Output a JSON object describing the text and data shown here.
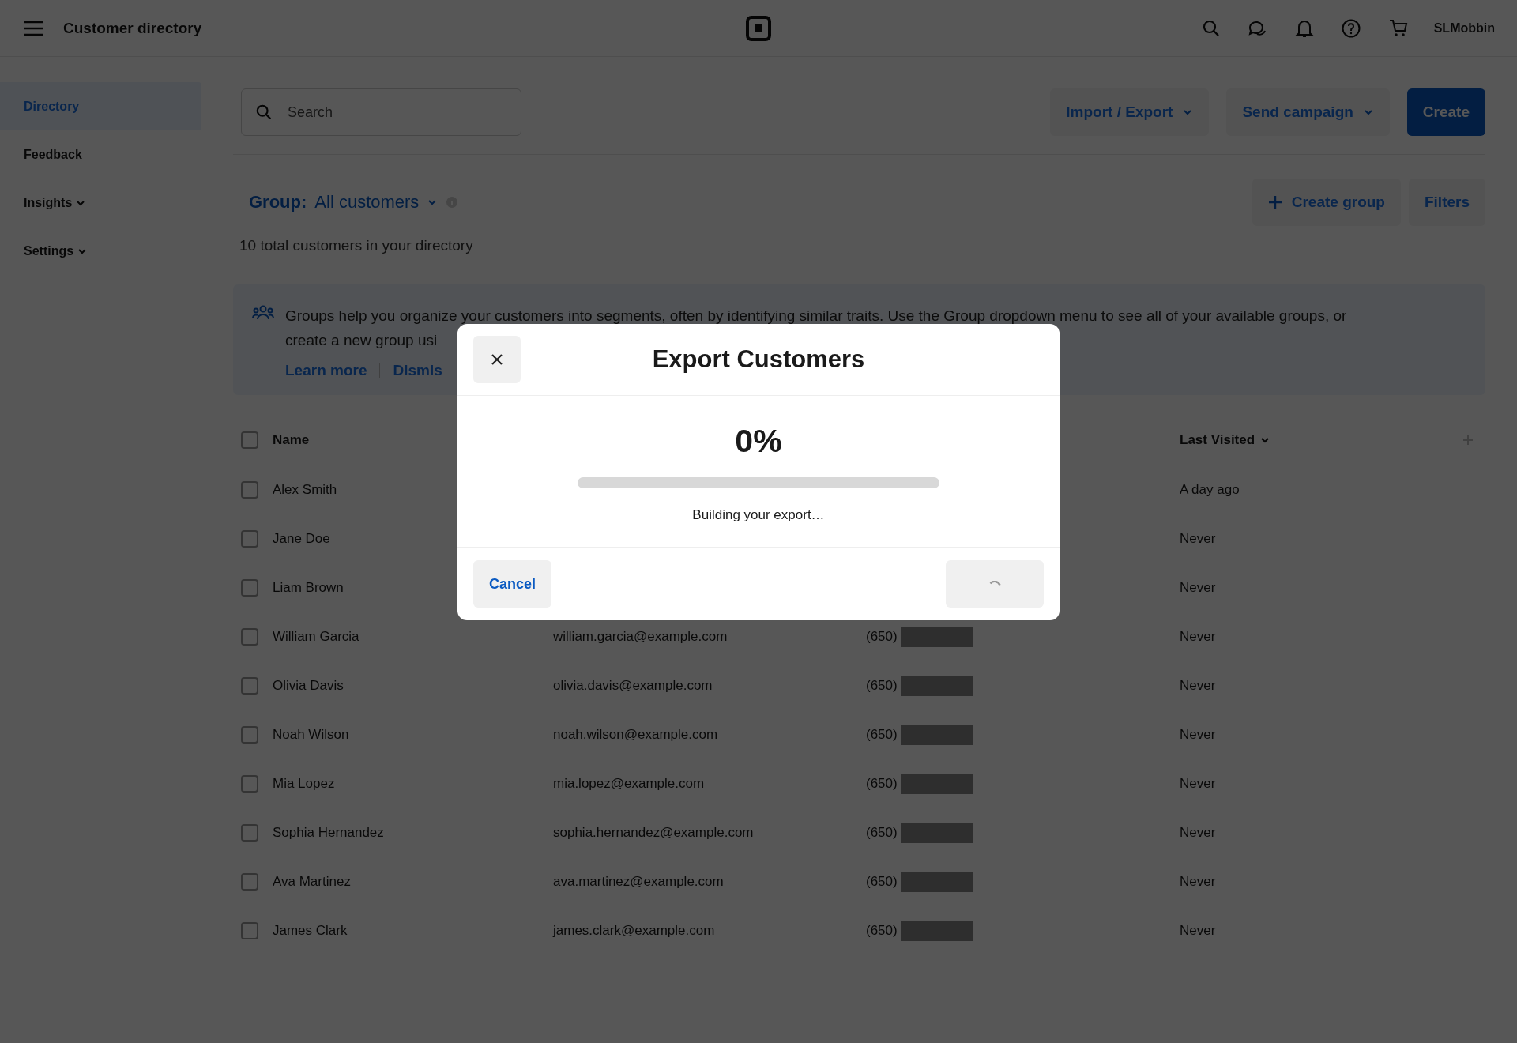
{
  "topbar": {
    "title": "Customer directory",
    "user": "SLMobbin"
  },
  "sidebar": {
    "items": [
      {
        "label": "Directory",
        "selected": true,
        "kind": "link"
      },
      {
        "label": "Feedback",
        "selected": false,
        "kind": "link"
      },
      {
        "label": "Insights",
        "selected": false,
        "kind": "menu"
      },
      {
        "label": "Settings",
        "selected": false,
        "kind": "menu"
      }
    ]
  },
  "toolbar": {
    "search": {
      "placeholder": "Search"
    },
    "buttons": [
      {
        "label": "Import / Export",
        "kind": "dropdown"
      },
      {
        "label": "Send campaign",
        "kind": "dropdown"
      },
      {
        "label": "Create",
        "kind": "primary"
      }
    ]
  },
  "group": {
    "label": "Group:",
    "value": "All customers",
    "count_text": "10 total customers in your directory",
    "buttons": [
      {
        "label": "Create group",
        "kind": "add"
      },
      {
        "label": "Filters",
        "kind": "plain"
      }
    ]
  },
  "banner": {
    "lines": [
      "Groups help you organize your customers into segments, often by identifying similar traits. Use the Group dropdown menu to see all of your available groups, or",
      "create a new group usi"
    ],
    "links": [
      "Learn more",
      "Dismis"
    ]
  },
  "table": {
    "header_checked": false,
    "columns": [
      {
        "label": "Name"
      },
      {
        "label": "Last Visited"
      }
    ],
    "rows": [
      {
        "name": "Alex Smith",
        "last_visited": "A day ago",
        "checked": false
      },
      {
        "name": "Jane Doe",
        "last_visited": "Never",
        "checked": false
      },
      {
        "name": "Liam Brown",
        "last_visited": "Never",
        "checked": false
      },
      {
        "name": "William Garcia",
        "email": "william.garcia@example.com",
        "phone": "(650)",
        "redacted": true,
        "last_visited": "Never",
        "checked": false
      },
      {
        "name": "Olivia Davis",
        "email": "olivia.davis@example.com",
        "phone": "(650)",
        "redacted": true,
        "last_visited": "Never",
        "checked": false
      },
      {
        "name": "Noah Wilson",
        "email": "noah.wilson@example.com",
        "phone": "(650)",
        "redacted": true,
        "last_visited": "Never",
        "checked": false
      },
      {
        "name": "Mia Lopez",
        "email": "mia.lopez@example.com",
        "phone": "(650)",
        "redacted": true,
        "last_visited": "Never",
        "checked": false
      },
      {
        "name": "Sophia Hernandez",
        "email": "sophia.hernandez@example.com",
        "phone": "(650)",
        "redacted": true,
        "last_visited": "Never",
        "checked": false
      },
      {
        "name": "Ava Martinez",
        "email": "ava.martinez@example.com",
        "phone": "(650)",
        "redacted": true,
        "last_visited": "Never",
        "checked": false
      },
      {
        "name": "James Clark",
        "email": "james.clark@example.com",
        "phone": "(650)",
        "redacted": true,
        "last_visited": "Never",
        "checked": false
      }
    ]
  },
  "modal": {
    "title": "Export Customers",
    "percent": "0%",
    "level": 0,
    "status": "Building your export…",
    "cancel": "Cancel",
    "confirm_loading": true
  }
}
